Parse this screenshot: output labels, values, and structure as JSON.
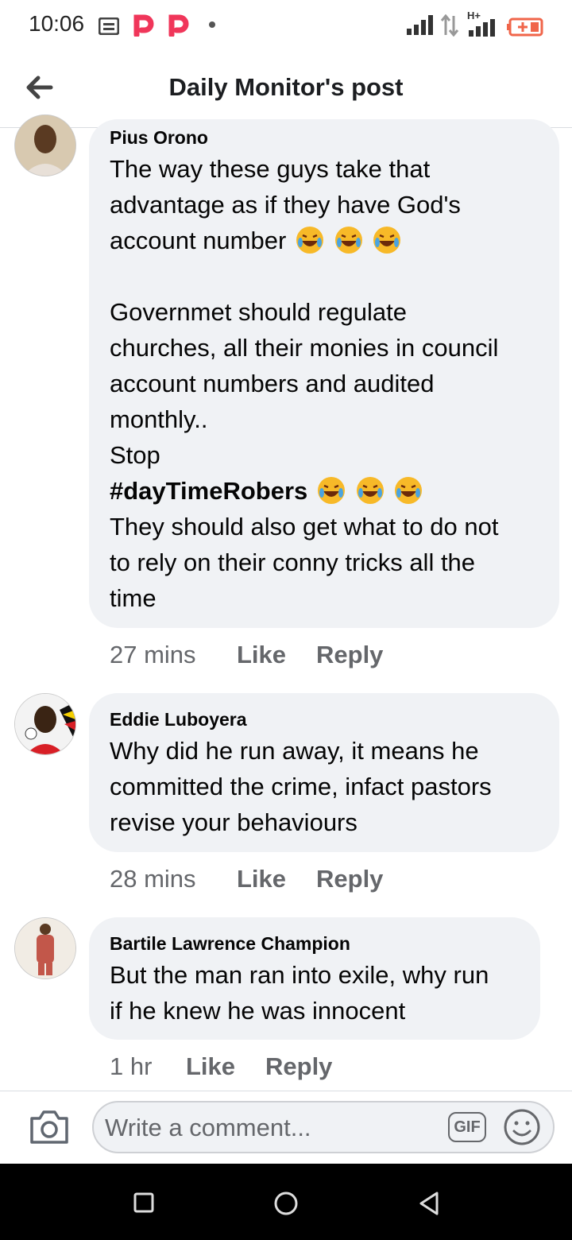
{
  "status_bar": {
    "time": "10:06",
    "network": "H+"
  },
  "header": {
    "title": "Daily Monitor's post"
  },
  "comments": [
    {
      "author": "Pius Orono",
      "lines": [
        "The way these guys take that",
        "advantage as if they have God's",
        "account number",
        "",
        "Governmet should regulate",
        "churches, all their monies in council",
        "account numbers and audited",
        "monthly..",
        "Stop",
        "#dayTimeRobers",
        "They should also get what to do not",
        "to rely on their conny tricks all the",
        "time"
      ],
      "time": "27 mins",
      "like": "Like",
      "reply": "Reply"
    },
    {
      "author": "Eddie Luboyera",
      "lines": [
        "Why did he run away, it means he",
        "committed the crime, infact pastors",
        "revise your behaviours"
      ],
      "time": "28 mins",
      "like": "Like",
      "reply": "Reply"
    },
    {
      "author": "Bartile Lawrence Champion",
      "lines": [
        "But the man ran into exile, why run",
        "if he knew he was innocent"
      ],
      "time": "1 hr",
      "like": "Like",
      "reply": "Reply"
    }
  ],
  "composer": {
    "placeholder": "Write a comment...",
    "gif_label": "GIF"
  },
  "icons": [
    "back-arrow-icon",
    "camera-icon",
    "gif-icon",
    "emoji-icon",
    "laughing-emoji-icon",
    "nav-recents-icon",
    "nav-home-icon",
    "nav-back-icon"
  ],
  "colors": {
    "bubble": "#f0f2f5",
    "meta": "#65676b",
    "emoji": "#f7b928"
  }
}
